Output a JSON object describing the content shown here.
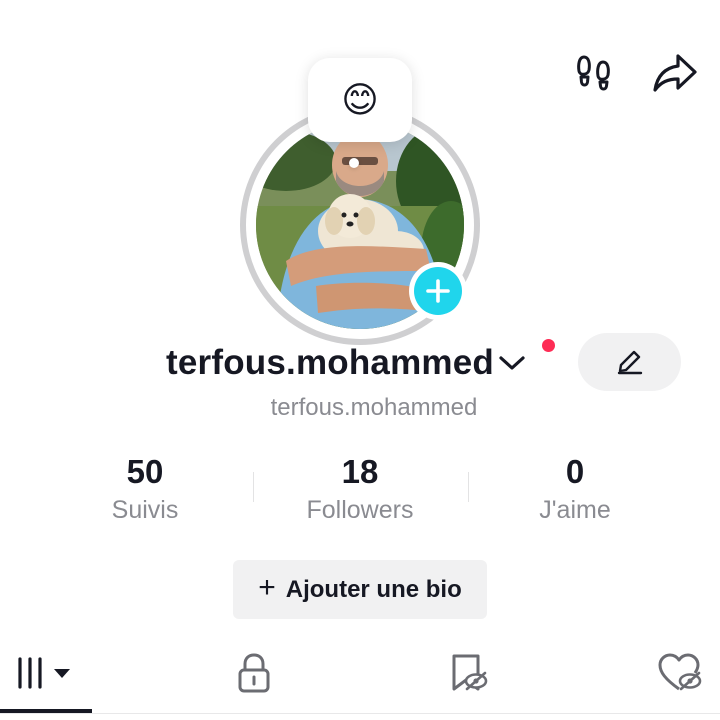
{
  "header": {
    "icons": [
      "footprints-icon",
      "share-arrow-icon"
    ]
  },
  "profile": {
    "status_emoji": "😊",
    "display_name": "terfous.mohammed",
    "username": "terfous.mohammed",
    "has_notification": true
  },
  "stats": [
    {
      "value": "50",
      "label": "Suivis"
    },
    {
      "value": "18",
      "label": "Followers"
    },
    {
      "value": "0",
      "label": "J'aime"
    }
  ],
  "bio_button": {
    "plus": "+",
    "label": "Ajouter une bio"
  },
  "tabs": [
    {
      "icon": "grid-icon",
      "selected": true,
      "has_dropdown": true
    },
    {
      "icon": "lock-icon",
      "selected": false
    },
    {
      "icon": "bookmark-icon",
      "selected": false
    },
    {
      "icon": "liked-heart-icon",
      "selected": false
    }
  ],
  "colors": {
    "accent": "#20d5ec",
    "notification": "#fe2c55",
    "text": "#161823",
    "secondary": "#8a8b91",
    "button_bg": "#f1f1f2"
  }
}
